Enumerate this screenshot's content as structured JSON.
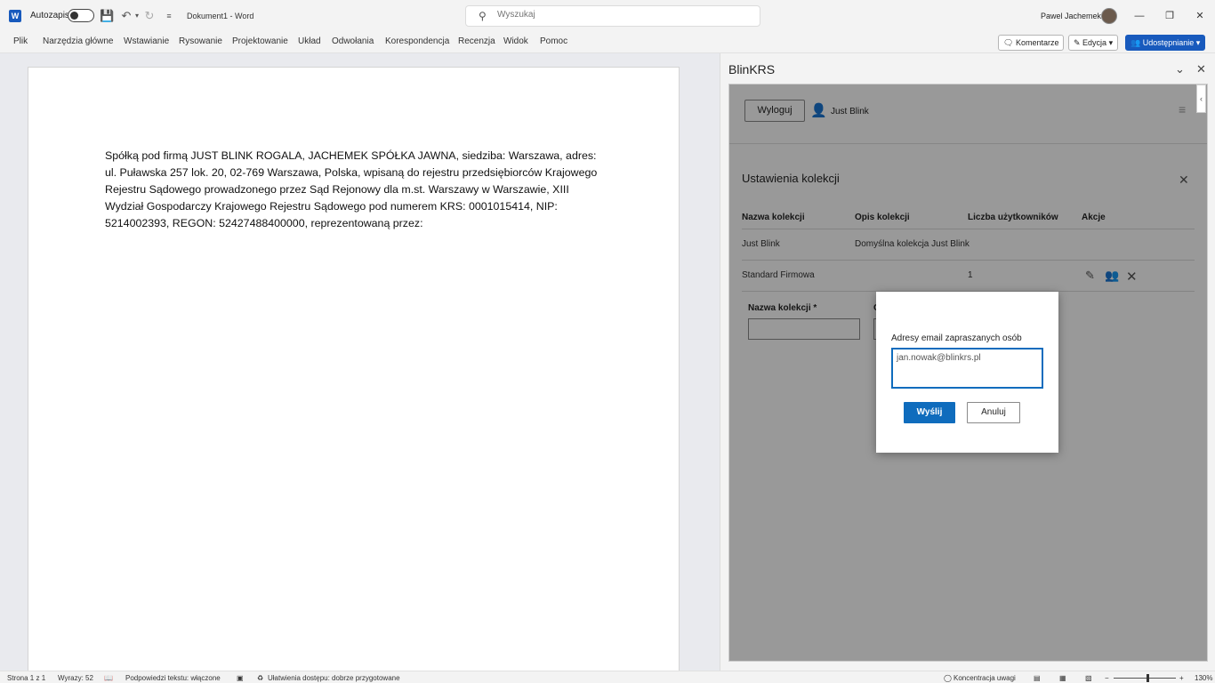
{
  "titlebar": {
    "autosave_label": "Autozapis",
    "doc_title": "Dokument1 - Word",
    "search_placeholder": "Wyszukaj",
    "user_name": "Pawel Jachemek"
  },
  "ribbon": {
    "tabs": [
      "Plik",
      "Narzędzia główne",
      "Wstawianie",
      "Rysowanie",
      "Projektowanie",
      "Układ",
      "Odwołania",
      "Korespondencja",
      "Recenzja",
      "Widok",
      "Pomoc"
    ],
    "comments_label": "Komentarze",
    "edit_label": "Edycja",
    "share_label": "Udostępnianie"
  },
  "document": {
    "paragraph": "Spółką pod firmą JUST BLINK ROGALA, JACHEMEK SPÓŁKA JAWNA, siedziba: Warszawa, adres: ul. Puławska 257 lok. 20, 02-769 Warszawa, Polska, wpisaną do rejestru przedsiębiorców Krajowego Rejestru Sądowego prowadzonego przez Sąd Rejonowy dla m.st. Warszawy w Warszawie, XIII Wydział Gospodarczy Krajowego Rejestru Sądowego pod numerem KRS: 0001015414, NIP: 5214002393, REGON: 52427488400000, reprezentowaną przez:"
  },
  "pane": {
    "title": "BlinKRS",
    "logout_label": "Wyloguj",
    "user_label": "Just Blink",
    "settings_title": "Ustawienia kolekcji",
    "columns": [
      "Nazwa kolekcji",
      "Opis kolekcji",
      "Liczba użytkowników",
      "Akcje"
    ],
    "rows": [
      {
        "name": "Just Blink",
        "desc": "Domyślna kolekcja Just Blink",
        "count": ""
      },
      {
        "name": "Standard Firmowa",
        "desc": "",
        "count": "1"
      }
    ],
    "form_name_label": "Nazwa kolekcji *",
    "form_desc_label": "O"
  },
  "dialog": {
    "label": "Adresy email zapraszanych osób",
    "email_value": "jan.nowak@blinkrs.pl",
    "send_label": "Wyślij",
    "cancel_label": "Anuluj"
  },
  "statusbar": {
    "page": "Strona 1 z 1",
    "words": "Wyrazy: 52",
    "text_predictions": "Podpowiedzi tekstu: włączone",
    "accessibility": "Ułatwienia dostępu: dobrze przygotowane",
    "focus": "Koncentracja uwagi",
    "zoom": "130%"
  },
  "colors": {
    "accent": "#185abd",
    "dialog_primary": "#0f6cbd"
  }
}
